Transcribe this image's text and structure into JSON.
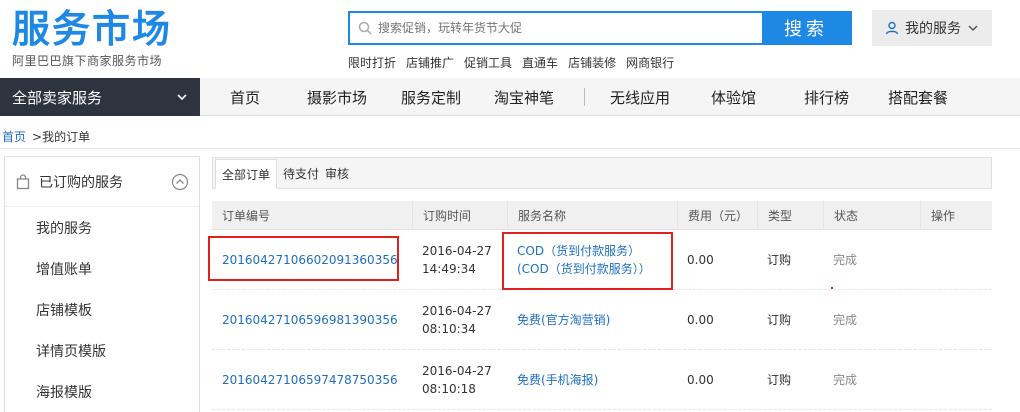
{
  "header": {
    "logo_main": "服务市场",
    "logo_sub": "阿里巴巴旗下商家服务市场",
    "search_placeholder": "搜索促销，玩转年货节大促",
    "search_button": "搜索",
    "my_service": "我的服务",
    "hot_links": [
      "限时打折",
      "店铺推广",
      "促销工具",
      "直通车",
      "店铺装修",
      "网商银行"
    ]
  },
  "nav": {
    "category": "全部卖家服务",
    "items": [
      "首页",
      "摄影市场",
      "服务定制",
      "淘宝神笔",
      "无线应用",
      "体验馆",
      "排行榜",
      "搭配套餐"
    ]
  },
  "breadcrumb": {
    "home": "首页",
    "current": ">我的订单"
  },
  "sidebar": {
    "head": "已订购的服务",
    "items": [
      "我的服务",
      "增值账单",
      "店铺模板",
      "详情页模版",
      "海报模版"
    ]
  },
  "tabs": [
    "全部订单",
    "待支付",
    "审核"
  ],
  "table": {
    "headers": [
      "订单编号",
      "订购时间",
      "服务名称",
      "费用（元）",
      "类型",
      "状态",
      "操作"
    ],
    "rows": [
      {
        "order": "20160427106602091360356",
        "date": "2016-04-27",
        "time": "14:49:34",
        "service": "COD（货到付款服务）(COD（货到付款服务））",
        "fee": "0.00",
        "type": "订购",
        "status": "完成"
      },
      {
        "order": "20160427106596981390356",
        "date": "2016-04-27",
        "time": "08:10:34",
        "service": "免费(官方淘营销)",
        "fee": "0.00",
        "type": "订购",
        "status": "完成"
      },
      {
        "order": "20160427106597478750356",
        "date": "2016-04-27",
        "time": "08:10:18",
        "service": "免费(手机海报)",
        "fee": "0.00",
        "type": "订购",
        "status": "完成"
      }
    ]
  },
  "colors": {
    "brand_blue": "#1e88e5",
    "link_blue": "#1e6fbf",
    "nav_dark": "#2d3440",
    "highlight_red": "#e02020"
  }
}
